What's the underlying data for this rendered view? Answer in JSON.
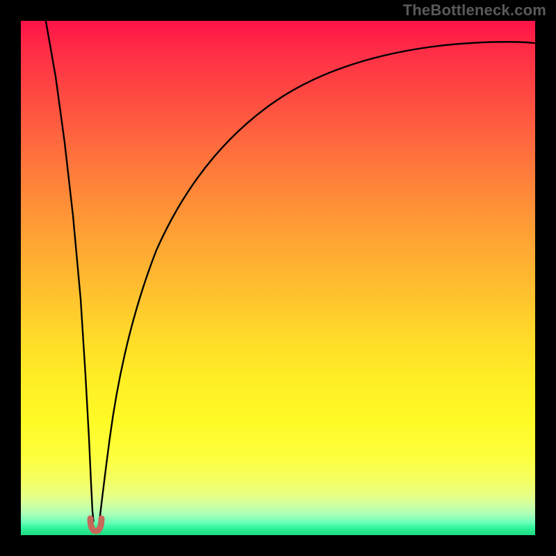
{
  "watermark": "TheBottleneck.com",
  "chart_data": {
    "type": "line",
    "title": "",
    "xlabel": "",
    "ylabel": "",
    "xlim": [
      0,
      100
    ],
    "ylim": [
      0,
      100
    ],
    "grid": false,
    "notes": "Heat-map style background gradient (red top → green bottom) with a single black V-shaped curve whose minimum (≈x=14) touches the bottom. A small reddish marker sits at the minimum.",
    "gradient_stops": [
      {
        "pos": 0,
        "color": "#ff1347"
      },
      {
        "pos": 14,
        "color": "#ff4842"
      },
      {
        "pos": 34,
        "color": "#ff8a38"
      },
      {
        "pos": 54,
        "color": "#ffc42e"
      },
      {
        "pos": 78,
        "color": "#fffb26"
      },
      {
        "pos": 94,
        "color": "#d2ffa0"
      },
      {
        "pos": 100,
        "color": "#1bdc7e"
      }
    ],
    "series": [
      {
        "name": "left-branch",
        "x": [
          6.0,
          7.5,
          9.0,
          10.5,
          12.0,
          12.8,
          13.4,
          13.8
        ],
        "y": [
          100,
          84,
          67,
          50,
          32,
          18,
          8,
          3
        ]
      },
      {
        "name": "right-branch",
        "x": [
          15.0,
          15.6,
          16.5,
          18.0,
          20.0,
          23.0,
          27.0,
          33.0,
          40.0,
          50.0,
          62.0,
          76.0,
          90.0,
          100.0
        ],
        "y": [
          3,
          8,
          18,
          33,
          47,
          59,
          68,
          76,
          82,
          87,
          90.5,
          92.5,
          93.5,
          94.0
        ]
      }
    ],
    "marker": {
      "x": 14.2,
      "y": 2.3,
      "color": "#c56a5a",
      "shape": "u-notch"
    }
  }
}
